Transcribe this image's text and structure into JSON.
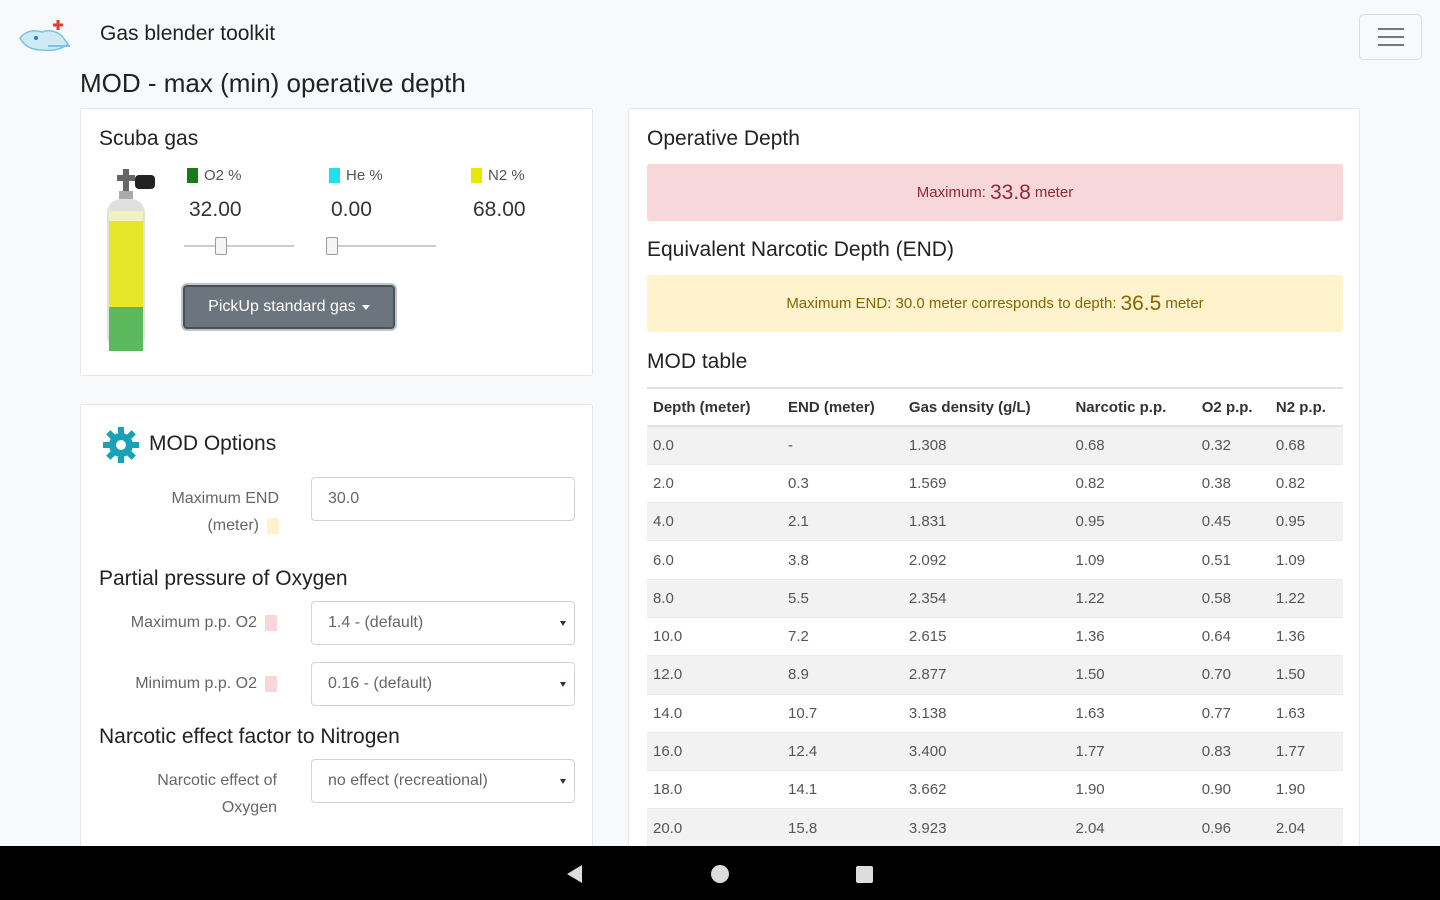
{
  "app": {
    "title": "Gas blender toolkit"
  },
  "page": {
    "title": "MOD - max (min) operative depth"
  },
  "colors": {
    "o2": "#1a7a1a",
    "he": "#1ee0f0",
    "n2": "#e8e800",
    "danger_bg": "#f8d7da",
    "warning_bg": "#fff3cd",
    "gear": "#17a2b8"
  },
  "scuba_gas": {
    "title": "Scuba gas",
    "o2": {
      "label": "O2 %",
      "value": "32.00",
      "slider_fraction": 0.32
    },
    "he": {
      "label": "He %",
      "value": "0.00",
      "slider_fraction": 0.0
    },
    "n2": {
      "label": "N2 %",
      "value": "68.00"
    },
    "pickup_label": "PickUp standard gas"
  },
  "options": {
    "title": "MOD Options",
    "max_end_label_1": "Maximum END",
    "max_end_label_2": "(meter)",
    "max_end_value": "30.0",
    "ppo2_heading": "Partial pressure of Oxygen",
    "max_ppo2_label": "Maximum p.p. O2",
    "max_ppo2_value": "1.4 - (default)",
    "min_ppo2_label": "Minimum p.p. O2",
    "min_ppo2_value": "0.16 - (default)",
    "narcotic_heading": "Narcotic effect factor to Nitrogen",
    "narcotic_label_1": "Narcotic effect of",
    "narcotic_label_2": "Oxygen",
    "narcotic_value": "no effect (recreational)"
  },
  "operative_depth": {
    "title": "Operative Depth",
    "max_prefix": "Maximum:",
    "max_value": "33.8",
    "max_unit": "meter"
  },
  "end": {
    "title": "Equivalent Narcotic Depth (END)",
    "prefix": "Maximum END: 30.0 meter corresponds to depth:",
    "value": "36.5",
    "unit": "meter"
  },
  "mod_table": {
    "title": "MOD table",
    "headers": [
      "Depth (meter)",
      "END (meter)",
      "Gas density (g/L)",
      "Narcotic p.p.",
      "O2 p.p.",
      "N2 p.p."
    ],
    "rows": [
      [
        "0.0",
        "-",
        "1.308",
        "0.68",
        "0.32",
        "0.68"
      ],
      [
        "2.0",
        "0.3",
        "1.569",
        "0.82",
        "0.38",
        "0.82"
      ],
      [
        "4.0",
        "2.1",
        "1.831",
        "0.95",
        "0.45",
        "0.95"
      ],
      [
        "6.0",
        "3.8",
        "2.092",
        "1.09",
        "0.51",
        "1.09"
      ],
      [
        "8.0",
        "5.5",
        "2.354",
        "1.22",
        "0.58",
        "1.22"
      ],
      [
        "10.0",
        "7.2",
        "2.615",
        "1.36",
        "0.64",
        "1.36"
      ],
      [
        "12.0",
        "8.9",
        "2.877",
        "1.50",
        "0.70",
        "1.50"
      ],
      [
        "14.0",
        "10.7",
        "3.138",
        "1.63",
        "0.77",
        "1.63"
      ],
      [
        "16.0",
        "12.4",
        "3.400",
        "1.77",
        "0.83",
        "1.77"
      ],
      [
        "18.0",
        "14.1",
        "3.662",
        "1.90",
        "0.90",
        "1.90"
      ],
      [
        "20.0",
        "15.8",
        "3.923",
        "2.04",
        "0.96",
        "2.04"
      ]
    ]
  }
}
